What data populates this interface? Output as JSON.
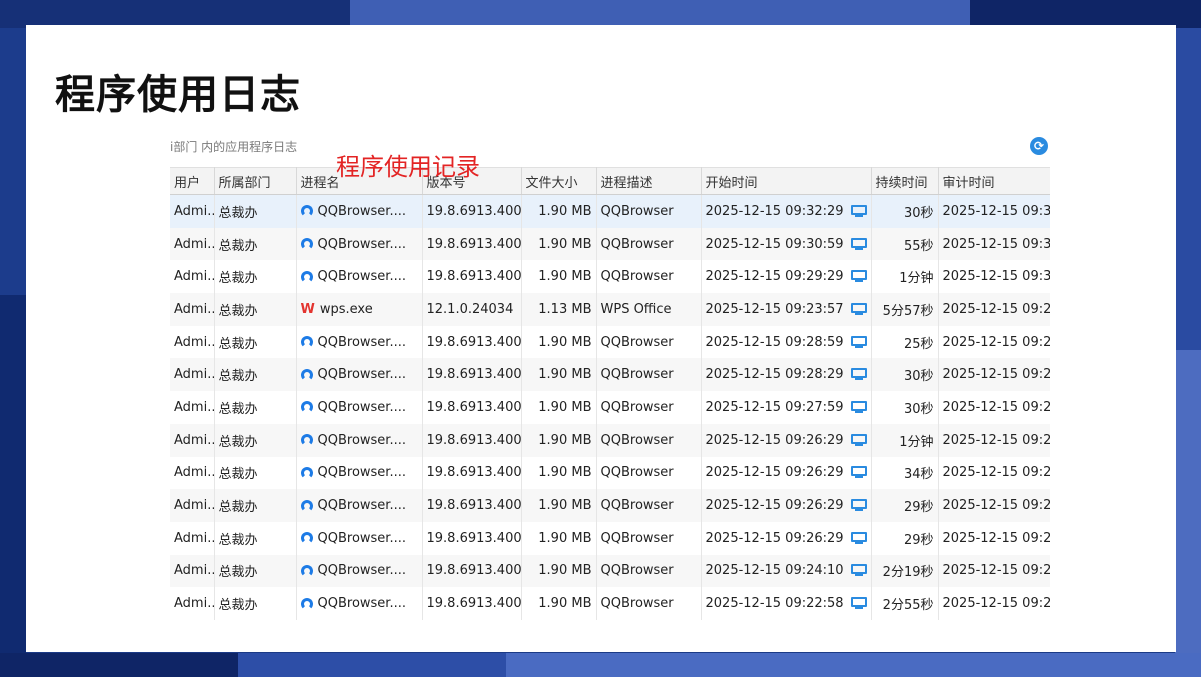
{
  "slide": {
    "title": "程序使用日志"
  },
  "window": {
    "scope_text": "i部门 内的应用程序日志",
    "annotation": "程序使用记录",
    "refresh_icon": "refresh-icon"
  },
  "table": {
    "columns": [
      "用户",
      "所属部门",
      "进程名",
      "版本号",
      "文件大小",
      "进程描述",
      "开始时间",
      "持续时间",
      "审计时间"
    ],
    "rows": [
      {
        "user": "Admi...",
        "dept": "总裁办",
        "icon": "qqbrowser",
        "proc": "QQBrowser....",
        "version": "19.8.6913.400",
        "size": "1.90 MB",
        "desc": "QQBrowser",
        "start": "2025-12-15 09:32:29",
        "duration": "30秒",
        "audit": "2025-12-15 09:3"
      },
      {
        "user": "Admi...",
        "dept": "总裁办",
        "icon": "qqbrowser",
        "proc": "QQBrowser....",
        "version": "19.8.6913.400",
        "size": "1.90 MB",
        "desc": "QQBrowser",
        "start": "2025-12-15 09:30:59",
        "duration": "55秒",
        "audit": "2025-12-15 09:3"
      },
      {
        "user": "Admi...",
        "dept": "总裁办",
        "icon": "qqbrowser",
        "proc": "QQBrowser....",
        "version": "19.8.6913.400",
        "size": "1.90 MB",
        "desc": "QQBrowser",
        "start": "2025-12-15 09:29:29",
        "duration": "1分钟",
        "audit": "2025-12-15 09:3"
      },
      {
        "user": "Admi...",
        "dept": "总裁办",
        "icon": "wps",
        "proc": "wps.exe",
        "version": "12.1.0.24034",
        "size": "1.13 MB",
        "desc": "WPS Office",
        "start": "2025-12-15 09:23:57",
        "duration": "5分57秒",
        "audit": "2025-12-15 09:2"
      },
      {
        "user": "Admi...",
        "dept": "总裁办",
        "icon": "qqbrowser",
        "proc": "QQBrowser....",
        "version": "19.8.6913.400",
        "size": "1.90 MB",
        "desc": "QQBrowser",
        "start": "2025-12-15 09:28:59",
        "duration": "25秒",
        "audit": "2025-12-15 09:2"
      },
      {
        "user": "Admi...",
        "dept": "总裁办",
        "icon": "qqbrowser",
        "proc": "QQBrowser....",
        "version": "19.8.6913.400",
        "size": "1.90 MB",
        "desc": "QQBrowser",
        "start": "2025-12-15 09:28:29",
        "duration": "30秒",
        "audit": "2025-12-15 09:2"
      },
      {
        "user": "Admi...",
        "dept": "总裁办",
        "icon": "qqbrowser",
        "proc": "QQBrowser....",
        "version": "19.8.6913.400",
        "size": "1.90 MB",
        "desc": "QQBrowser",
        "start": "2025-12-15 09:27:59",
        "duration": "30秒",
        "audit": "2025-12-15 09:2"
      },
      {
        "user": "Admi...",
        "dept": "总裁办",
        "icon": "qqbrowser",
        "proc": "QQBrowser....",
        "version": "19.8.6913.400",
        "size": "1.90 MB",
        "desc": "QQBrowser",
        "start": "2025-12-15 09:26:29",
        "duration": "1分钟",
        "audit": "2025-12-15 09:2"
      },
      {
        "user": "Admi...",
        "dept": "总裁办",
        "icon": "qqbrowser",
        "proc": "QQBrowser....",
        "version": "19.8.6913.400",
        "size": "1.90 MB",
        "desc": "QQBrowser",
        "start": "2025-12-15 09:26:29",
        "duration": "34秒",
        "audit": "2025-12-15 09:2"
      },
      {
        "user": "Admi...",
        "dept": "总裁办",
        "icon": "qqbrowser",
        "proc": "QQBrowser....",
        "version": "19.8.6913.400",
        "size": "1.90 MB",
        "desc": "QQBrowser",
        "start": "2025-12-15 09:26:29",
        "duration": "29秒",
        "audit": "2025-12-15 09:2"
      },
      {
        "user": "Admi...",
        "dept": "总裁办",
        "icon": "qqbrowser",
        "proc": "QQBrowser....",
        "version": "19.8.6913.400",
        "size": "1.90 MB",
        "desc": "QQBrowser",
        "start": "2025-12-15 09:26:29",
        "duration": "29秒",
        "audit": "2025-12-15 09:2"
      },
      {
        "user": "Admi...",
        "dept": "总裁办",
        "icon": "qqbrowser",
        "proc": "QQBrowser....",
        "version": "19.8.6913.400",
        "size": "1.90 MB",
        "desc": "QQBrowser",
        "start": "2025-12-15 09:24:10",
        "duration": "2分19秒",
        "audit": "2025-12-15 09:2"
      },
      {
        "user": "Admi...",
        "dept": "总裁办",
        "icon": "qqbrowser",
        "proc": "QQBrowser....",
        "version": "19.8.6913.400",
        "size": "1.90 MB",
        "desc": "QQBrowser",
        "start": "2025-12-15 09:22:58",
        "duration": "2分55秒",
        "audit": "2025-12-15 09:2"
      }
    ]
  },
  "colors": {
    "accent": "#2a8be0",
    "annotation": "#e32424",
    "frame": "#1b3a86"
  }
}
